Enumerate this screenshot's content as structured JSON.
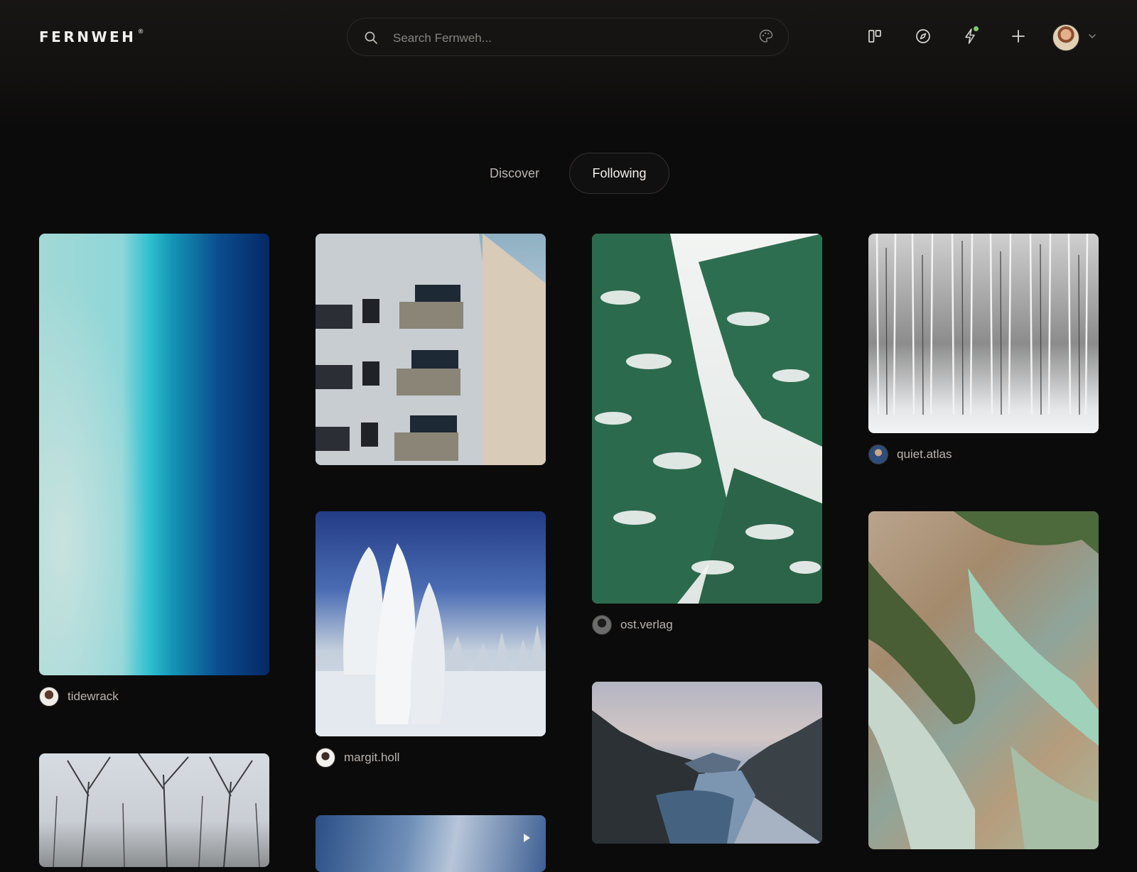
{
  "app": {
    "logo": "FERNWEH",
    "logo_mark": "®"
  },
  "search": {
    "placeholder": "Search Fernweh..."
  },
  "header_icons": [
    "layout-board-icon",
    "compass-icon",
    "bolt-icon",
    "plus-icon",
    "avatar",
    "chevron-down-icon"
  ],
  "notification_dot_color": "#7fc96b",
  "tabs": [
    {
      "label": "Discover",
      "active": false
    },
    {
      "label": "Following",
      "active": true
    }
  ],
  "feed": {
    "col1": [
      {
        "image": "aerial-turquoise-beach",
        "user": "tidewrack"
      },
      {
        "image": "bare-winter-trees",
        "user": ""
      }
    ],
    "col2": [
      {
        "image": "white-building-balconies",
        "user": ""
      },
      {
        "image": "snow-covered-trees-blue-sky",
        "user": "margit.holl"
      },
      {
        "image": "cloudy-sky-video",
        "user": "",
        "video": true
      }
    ],
    "col3": [
      {
        "image": "snowy-fir-branches",
        "user": "ost.verlag"
      },
      {
        "image": "mountain-lake-dusk",
        "user": ""
      }
    ],
    "col4": [
      {
        "image": "snowy-birch-forest",
        "user": "quiet.atlas"
      },
      {
        "image": "aerial-river-delta",
        "user": ""
      }
    ]
  }
}
